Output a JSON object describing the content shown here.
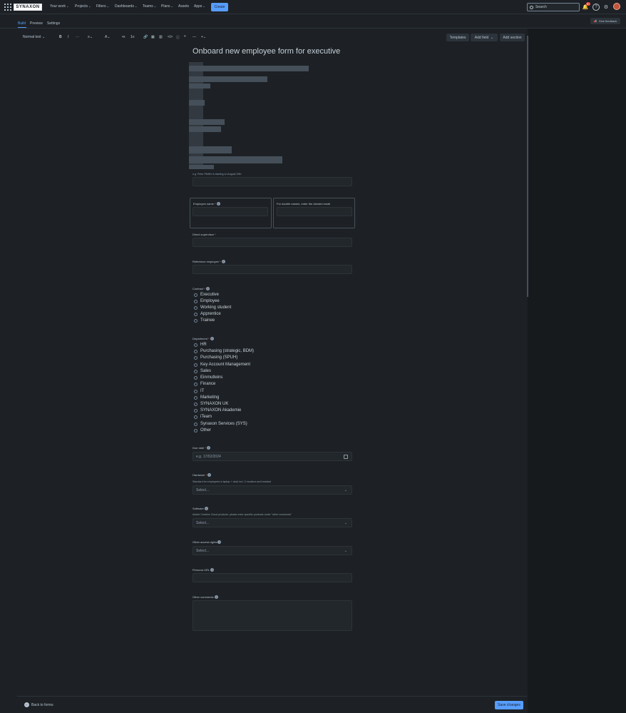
{
  "brand": {
    "logo_text": "SYNAXON",
    "accent": "#579dff",
    "background": "#1d2125"
  },
  "topnav": {
    "items": [
      {
        "label": "Your work",
        "dropdown": true
      },
      {
        "label": "Projects",
        "dropdown": true
      },
      {
        "label": "Filters",
        "dropdown": true
      },
      {
        "label": "Dashboards",
        "dropdown": true
      },
      {
        "label": "Teams",
        "dropdown": true
      },
      {
        "label": "Plans",
        "dropdown": true
      },
      {
        "label": "Assets",
        "dropdown": false
      },
      {
        "label": "Apps",
        "dropdown": true
      }
    ],
    "create_label": "Create",
    "search_placeholder": "Search",
    "notification_count": "9+"
  },
  "tabs": {
    "items": [
      {
        "label": "Build",
        "active": true
      },
      {
        "label": "Preview",
        "active": false
      },
      {
        "label": "Settings",
        "active": false
      }
    ],
    "feedback_label": "Give feedback"
  },
  "toolbar": {
    "text_style": "Normal text",
    "templates_label": "Templates",
    "add_field_label": "Add field",
    "add_section_label": "Add section"
  },
  "form": {
    "title": "Onboard new employee form for executive",
    "intro_hint": "e.g. Peter Pfeffer is starting on August 20th",
    "employee_name": {
      "label": "Employee name",
      "required": "*"
    },
    "double_names": {
      "label": "For double names, enter the desired email"
    },
    "direct_supervisor": {
      "label": "Direct supervisor",
      "required": "*"
    },
    "reference_employee": {
      "label": "Reference employee",
      "required": "*"
    },
    "contract": {
      "label": "Contract",
      "required": "*",
      "options": [
        "Executive",
        "Employee",
        "Working student",
        "Apprentice",
        "Trainee"
      ]
    },
    "department": {
      "label": "Department",
      "required": "*",
      "options": [
        "HR",
        "Purchasing (strategic, BDM)",
        "Purchasing (SPUH)",
        "Key Account Management",
        "Sales",
        "Einrnutleins",
        "Finance",
        "IT",
        "Marketing",
        "SYNAXON UK",
        "SYNAXON Akademie",
        "iTeam",
        "Synaxon Services (SYS)",
        "Other"
      ]
    },
    "due_date": {
      "label": "Due date",
      "required": "*",
      "placeholder": "e.g. 17/02/2024"
    },
    "hardware": {
      "label": "Hardware",
      "required": "*",
      "hint": "Standard for employees is laptop + dock incl. 2 monitors and headset",
      "placeholder": "Select..."
    },
    "software": {
      "label": "Software",
      "hint": "Adobe Creative Cloud products: please enter specific products under \"other comments\"",
      "placeholder": "Select..."
    },
    "other_access": {
      "label": "Other access rights",
      "placeholder": "Select..."
    },
    "persona_url": {
      "label": "Persona URL"
    },
    "other_comments": {
      "label": "Other comments"
    }
  },
  "footer": {
    "back_label": "Back to forms",
    "save_label": "Save changes"
  }
}
